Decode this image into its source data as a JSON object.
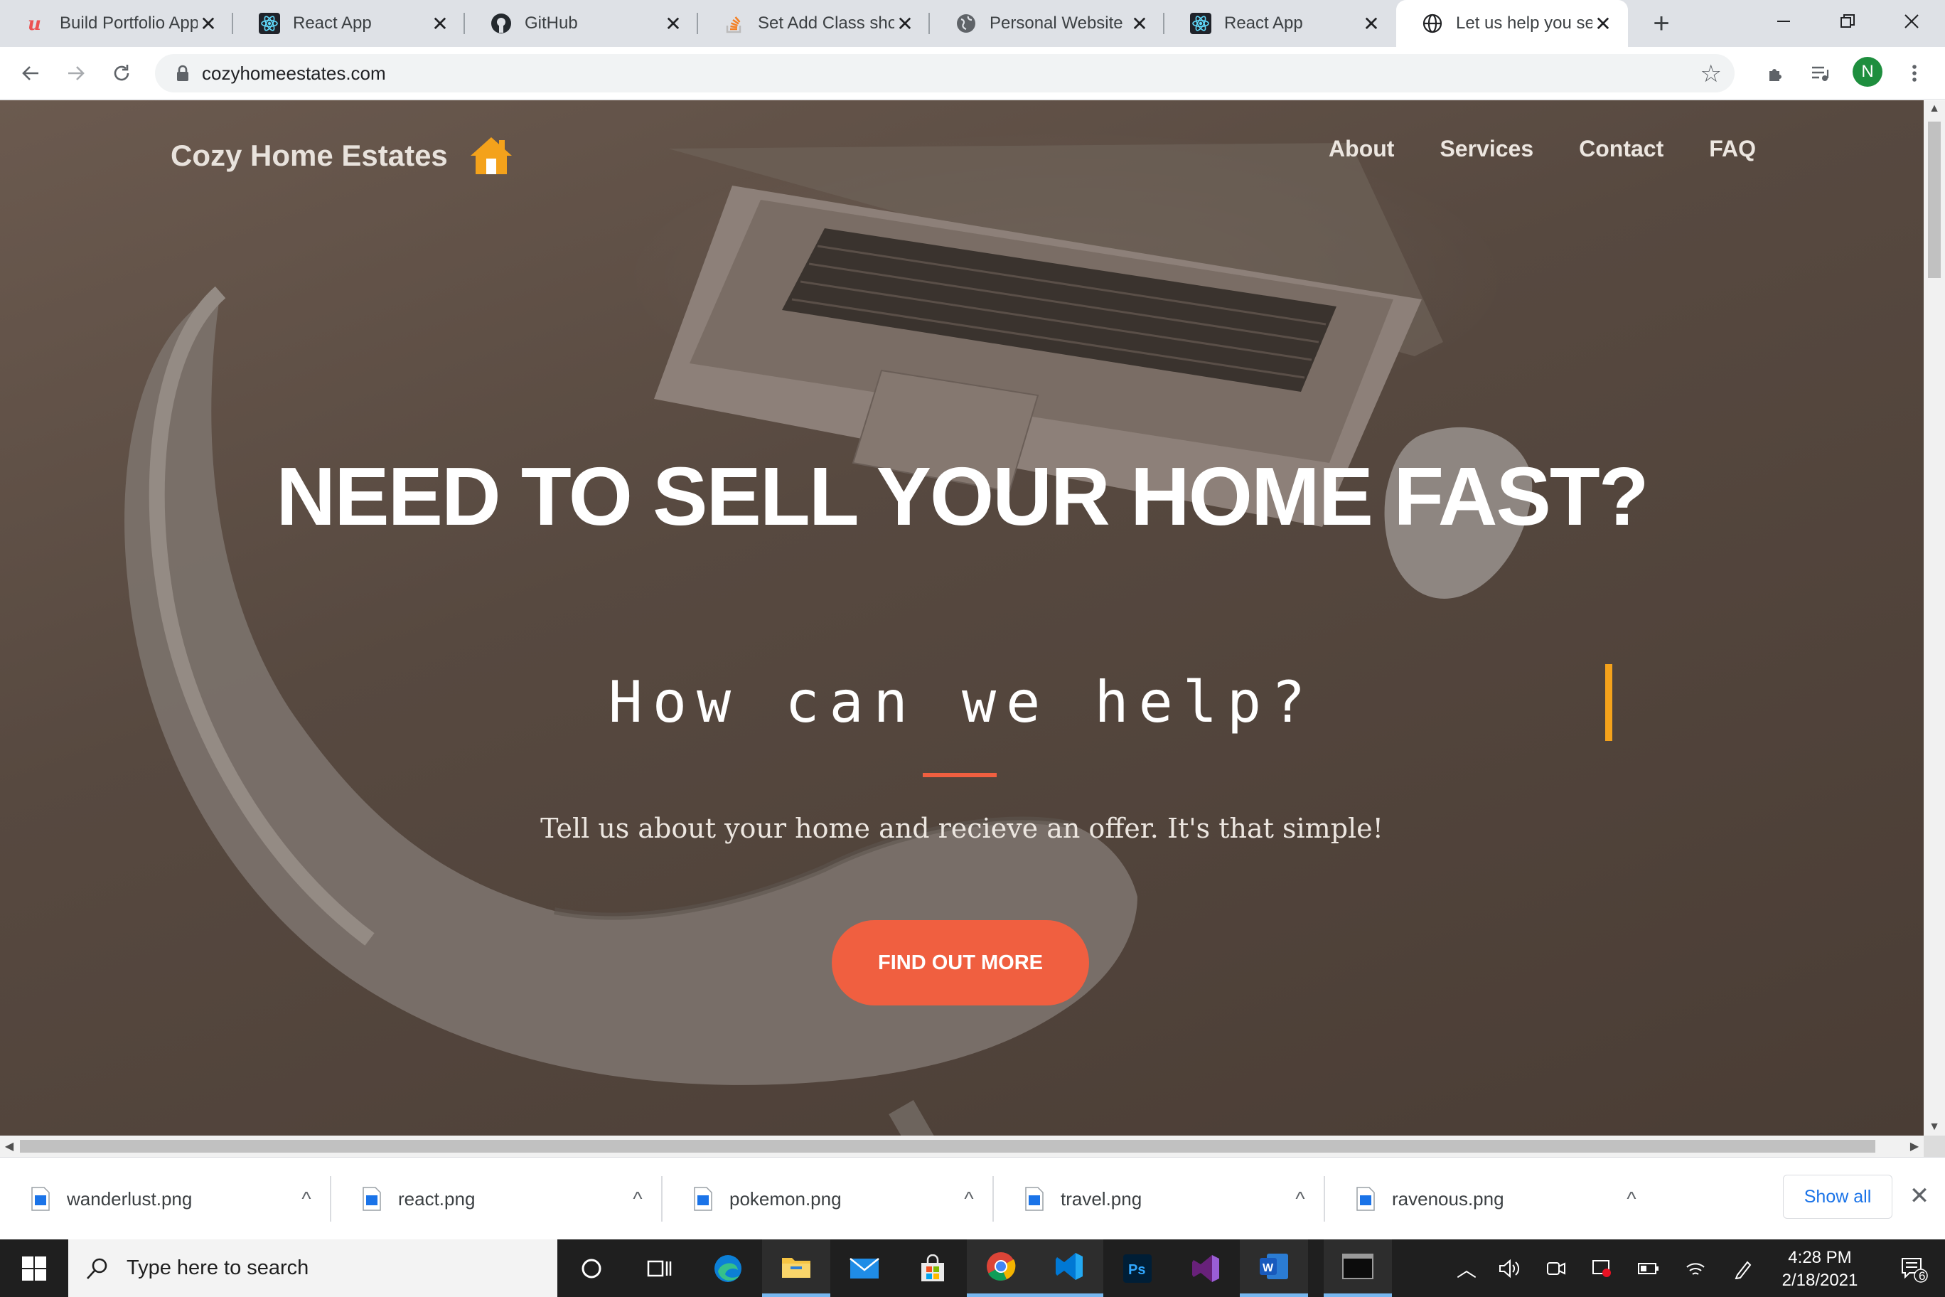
{
  "browser": {
    "tabs": [
      {
        "title": "Build Portfolio App",
        "icon": "udemy-icon",
        "active": false
      },
      {
        "title": "React App",
        "icon": "react-icon",
        "active": false
      },
      {
        "title": "GitHub",
        "icon": "github-icon",
        "active": false
      },
      {
        "title": "Set Add Class shor",
        "icon": "stackoverflow-icon",
        "active": false
      },
      {
        "title": "Personal Website",
        "icon": "globe-icon",
        "active": false
      },
      {
        "title": "React App",
        "icon": "react-icon",
        "active": false
      },
      {
        "title": "Let us help you sel",
        "icon": "globe-icon",
        "active": true
      }
    ],
    "url": "cozyhomeestates.com",
    "profile_initial": "N"
  },
  "site": {
    "brand": "Cozy Home Estates",
    "nav": [
      "About",
      "Services",
      "Contact",
      "FAQ"
    ],
    "headline": "NEED TO SELL YOUR HOME FAST?",
    "typed_text": "How can we help?",
    "tagline": "Tell us about your home and recieve an offer. It's that simple!",
    "cta_label": "FIND OUT MORE",
    "colors": {
      "accent": "#f05f40",
      "cursor": "#f4a21b",
      "home_icon": "#f4a21b"
    }
  },
  "downloads": {
    "files": [
      "wanderlust.png",
      "react.png",
      "pokemon.png",
      "travel.png",
      "ravenous.png"
    ],
    "show_all_label": "Show all"
  },
  "taskbar": {
    "search_placeholder": "Type here to search",
    "time": "4:28 PM",
    "date": "2/18/2021",
    "notification_count": "6"
  }
}
